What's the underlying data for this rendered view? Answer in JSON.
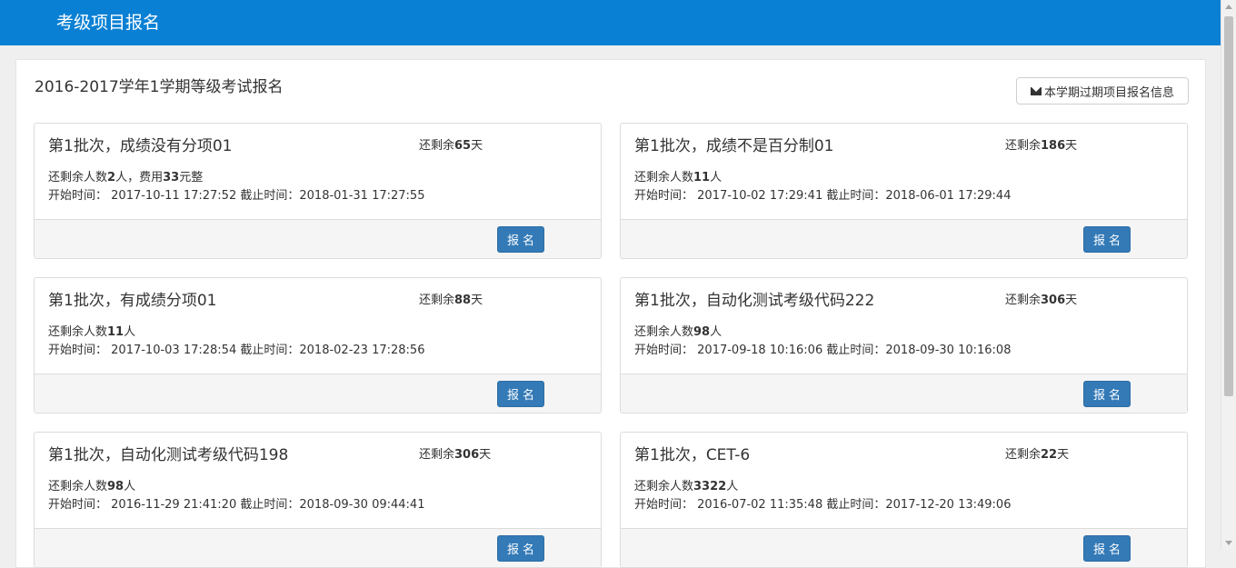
{
  "header": {
    "title": "考级项目报名"
  },
  "main": {
    "term_title": "2016-2017学年1学期等级考试报名",
    "history_button_label": "本学期过期项目报名信息",
    "remain_prefix": "还剩余",
    "remain_suffix": "天",
    "quota_prefix": "还剩余人数",
    "quota_suffix": "人",
    "start_label": "开始时间：",
    "end_label": "截止时间：",
    "signup_label": "报名",
    "cards": [
      {
        "name": "第1批次，成绩没有分项01",
        "days": "65",
        "quota": "2",
        "fee_prefix": "，费用",
        "fee": "33",
        "fee_suffix": "元整",
        "start": "2017-10-11 17:27:52",
        "end": "2018-01-31 17:27:55"
      },
      {
        "name": "第1批次，成绩不是百分制01",
        "days": "186",
        "quota": "11",
        "start": "2017-10-02 17:29:41",
        "end": "2018-06-01 17:29:44"
      },
      {
        "name": "第1批次，有成绩分项01",
        "days": "88",
        "quota": "11",
        "start": "2017-10-03 17:28:54",
        "end": "2018-02-23 17:28:56"
      },
      {
        "name": "第1批次，自动化测试考级代码222",
        "days": "306",
        "quota": "98",
        "start": "2017-09-18 10:16:06",
        "end": "2018-09-30 10:16:08"
      },
      {
        "name": "第1批次，自动化测试考级代码198",
        "days": "306",
        "quota": "98",
        "start": "2016-11-29 21:41:20",
        "end": "2018-09-30 09:44:41"
      },
      {
        "name": "第1批次，CET-6",
        "days": "22",
        "quota": "3322",
        "start": "2016-07-02 11:35:48",
        "end": "2017-12-20 13:49:06"
      }
    ]
  }
}
